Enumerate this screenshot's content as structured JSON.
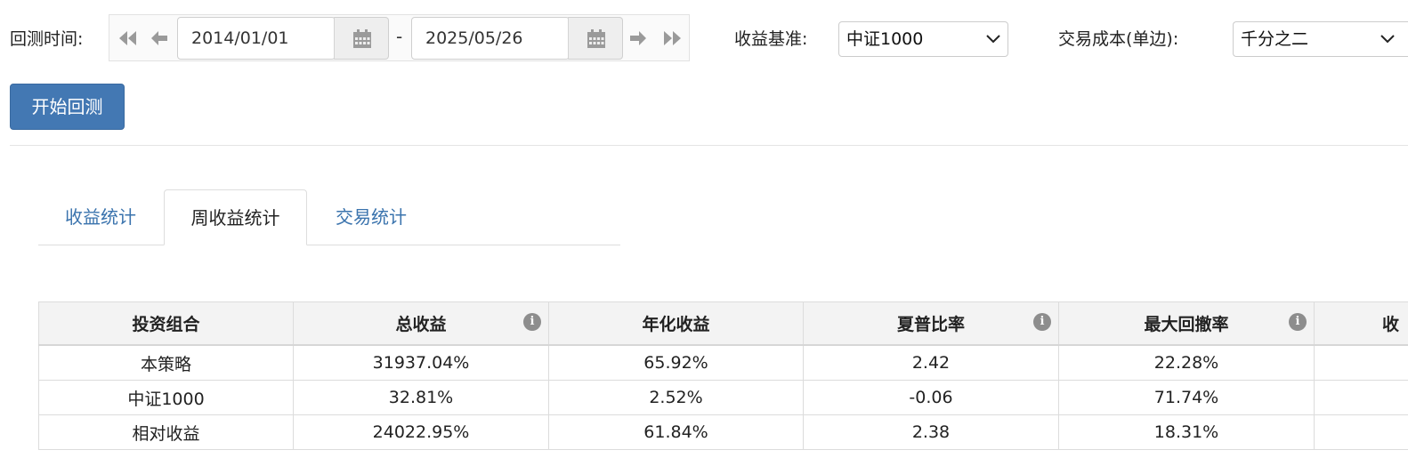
{
  "backtest_range": {
    "label": "回测时间:",
    "start_date": "2014/01/01",
    "separator": "-",
    "end_date": "2025/05/26"
  },
  "benchmark": {
    "label": "收益基准:",
    "selected": "中证1000"
  },
  "cost": {
    "label": "交易成本(单边):",
    "selected": "千分之二"
  },
  "start_button": "开始回测",
  "tabs": [
    {
      "label": "收益统计",
      "active": false
    },
    {
      "label": "周收益统计",
      "active": true
    },
    {
      "label": "交易统计",
      "active": false
    }
  ],
  "table": {
    "headers": [
      "投资组合",
      "总收益",
      "年化收益",
      "夏普比率",
      "最大回撤率",
      "收"
    ],
    "header_info_icon": "i",
    "rows": [
      [
        "本策略",
        "31937.04%",
        "65.92%",
        "2.42",
        "22.28%",
        ""
      ],
      [
        "中证1000",
        "32.81%",
        "2.52%",
        "-0.06",
        "71.74%",
        ""
      ],
      [
        "相对收益",
        "24022.95%",
        "61.84%",
        "2.38",
        "18.31%",
        ""
      ]
    ]
  },
  "colors": {
    "primary": "#4378b3",
    "link": "#3a73ad",
    "icon_gray": "#9a9a9a"
  }
}
